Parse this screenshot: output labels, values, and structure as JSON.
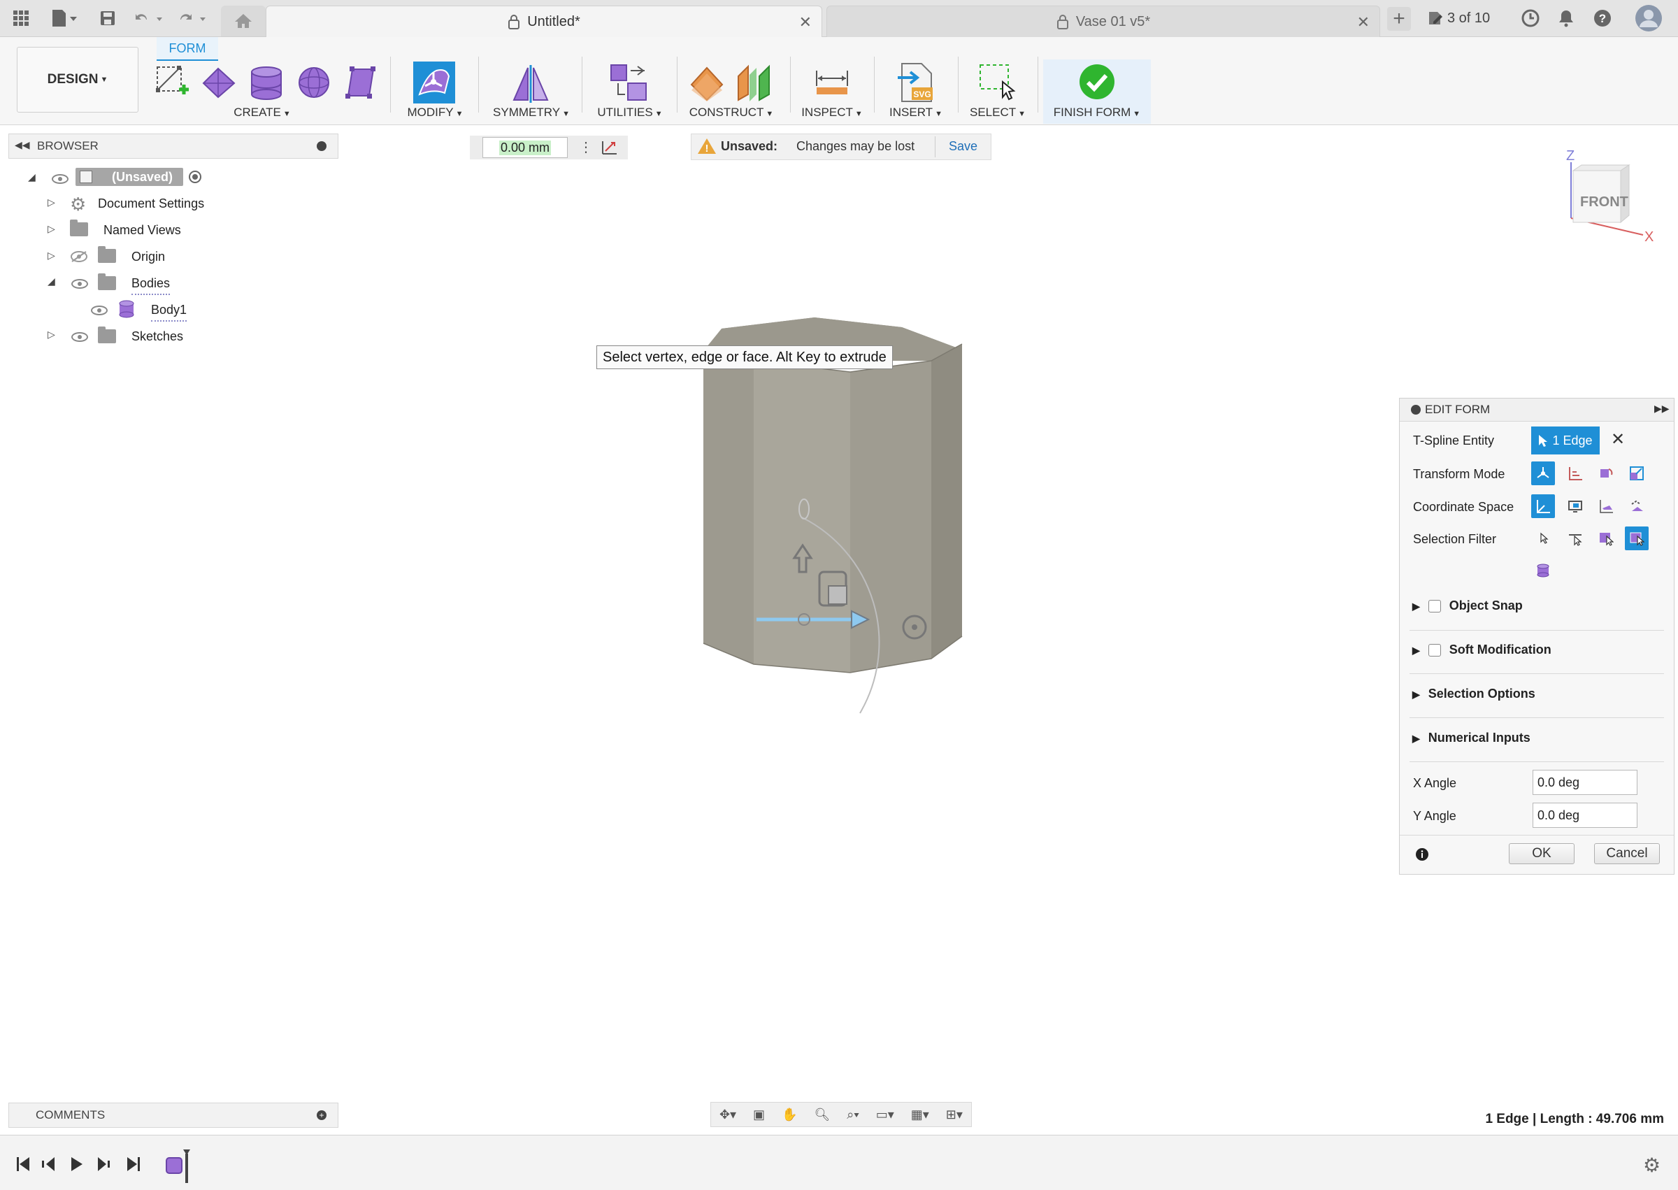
{
  "topbar": {
    "tabs": [
      {
        "title": "Untitled*",
        "active": true
      },
      {
        "title": "Vase 01 v5*",
        "active": false
      }
    ],
    "page_counter": "3 of 10"
  },
  "ribbon": {
    "workspace": "DESIGN",
    "active_tab": "FORM",
    "groups": {
      "create": "CREATE",
      "modify": "MODIFY",
      "symmetry": "SYMMETRY",
      "utilities": "UTILITIES",
      "construct": "CONSTRUCT",
      "inspect": "INSPECT",
      "insert": "INSERT",
      "select": "SELECT",
      "finish": "FINISH FORM"
    }
  },
  "browser": {
    "title": "BROWSER",
    "root": "(Unsaved)",
    "items": [
      "Document Settings",
      "Named Views",
      "Origin",
      "Bodies",
      "Body1",
      "Sketches"
    ]
  },
  "measure": {
    "value": "0.00 mm"
  },
  "unsaved": {
    "label": "Unsaved:",
    "message": "Changes may be lost",
    "save": "Save"
  },
  "viewcube": {
    "face": "FRONT",
    "z": "Z",
    "x": "X"
  },
  "tooltip": "Select vertex, edge or face. Alt Key to extrude",
  "edit_form": {
    "title": "EDIT FORM",
    "tspline_label": "T-Spline Entity",
    "tspline_value": "1 Edge",
    "transform_mode": "Transform Mode",
    "coordinate_space": "Coordinate Space",
    "selection_filter": "Selection Filter",
    "object_snap": "Object Snap",
    "soft_modification": "Soft Modification",
    "selection_options": "Selection Options",
    "numerical_inputs": "Numerical Inputs",
    "x_angle_label": "X Angle",
    "x_angle_value": "0.0 deg",
    "y_angle_label": "Y Angle",
    "y_angle_value": "0.0 deg",
    "ok": "OK",
    "cancel": "Cancel"
  },
  "comments": {
    "title": "COMMENTS"
  },
  "status": "1 Edge | Length : 49.706 mm",
  "colors": {
    "accent": "#1f8fd6",
    "body": "#9f9c91",
    "finish": "#2fb52f",
    "form_purple": "#9b6fd6"
  }
}
